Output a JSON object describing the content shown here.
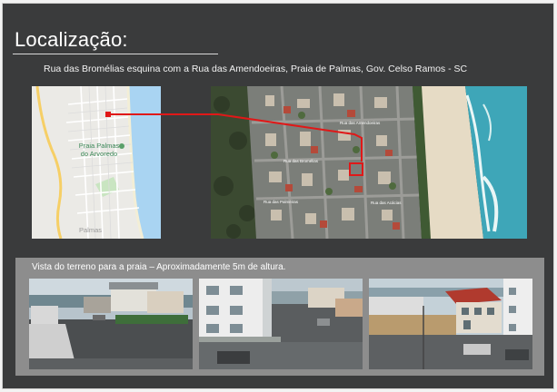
{
  "slide": {
    "title": "Localização:",
    "subtitle": "Rua das Bromélias esquina com a Rua das Amendoeiras, Praia de Palmas, Gov. Celso Ramos - SC",
    "photo_caption": "Vista do terreno  para a praia – Aproximadamente 5m de altura."
  },
  "map_small": {
    "poi_line1": "Praia Palmas",
    "poi_line2": "do Arvoredo",
    "town": "Palmas",
    "colors": {
      "sea": "#a9d4f2",
      "land": "#ebeae6",
      "highway": "#f6cf66",
      "park": "#c9e5c1"
    }
  },
  "satellite_map": {
    "street_labels": [
      "Rua das Bromélias",
      "Rua das Amendoeiras",
      "Rua das Palmeiras",
      "Rua das Acácias"
    ],
    "colors": {
      "sea": "#3ea6b8",
      "sand": "#e6dbc5",
      "forest": "#3b4a31"
    }
  },
  "marker": {
    "color": "#e01818"
  },
  "photos": [
    {
      "name": "photo-street-view",
      "description": ""
    },
    {
      "name": "photo-building-corner",
      "description": ""
    },
    {
      "name": "photo-neighbor-houses",
      "description": ""
    }
  ]
}
